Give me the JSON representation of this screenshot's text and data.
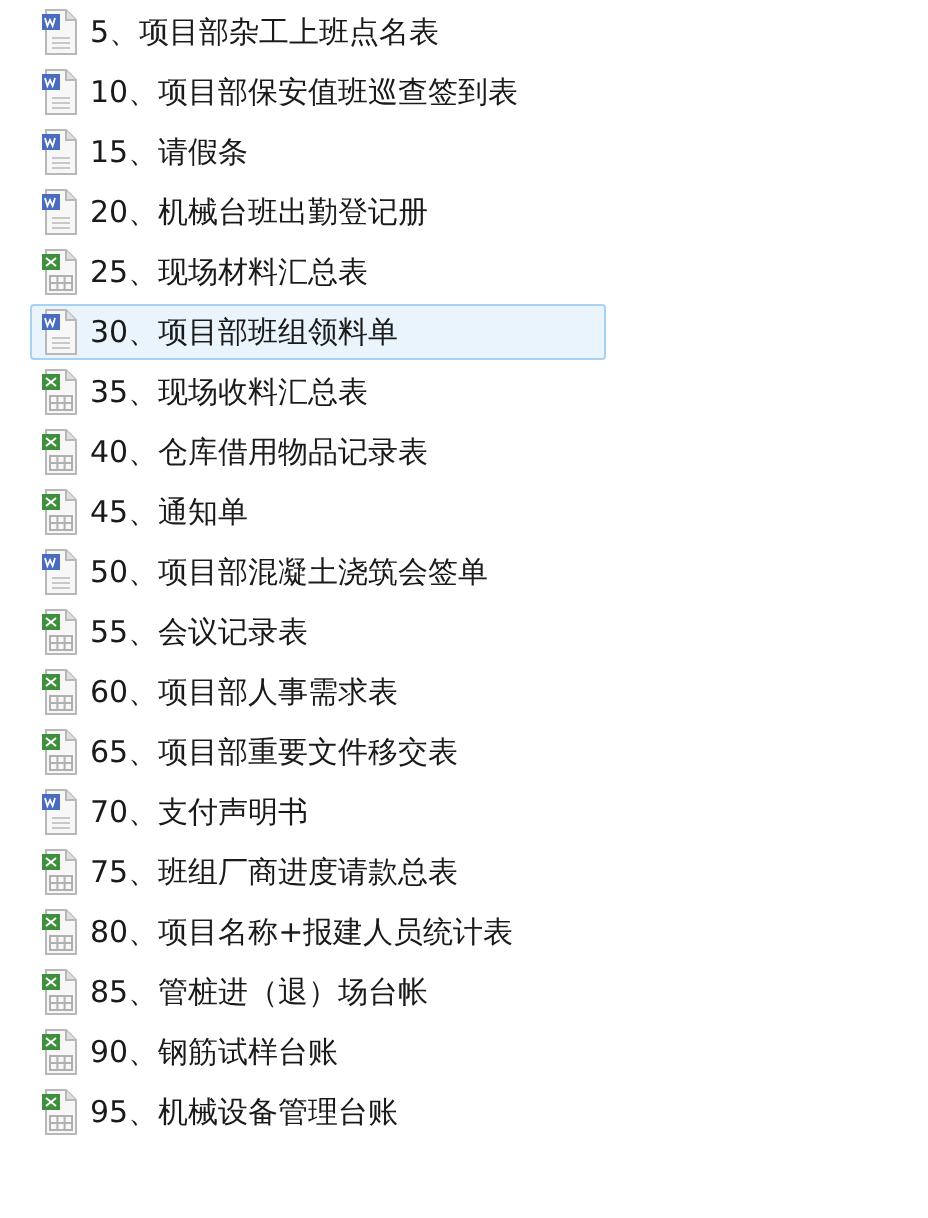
{
  "files": [
    {
      "name": "5、项目部杂工上班点名表",
      "kind": "word",
      "selected": false
    },
    {
      "name": "10、项目部保安值班巡查签到表",
      "kind": "word",
      "selected": false
    },
    {
      "name": "15、请假条",
      "kind": "word",
      "selected": false
    },
    {
      "name": "20、机械台班出勤登记册",
      "kind": "word",
      "selected": false
    },
    {
      "name": "25、现场材料汇总表",
      "kind": "excel",
      "selected": false
    },
    {
      "name": "30、项目部班组领料单",
      "kind": "word",
      "selected": true
    },
    {
      "name": "35、现场收料汇总表",
      "kind": "excel",
      "selected": false
    },
    {
      "name": "40、仓库借用物品记录表",
      "kind": "excel",
      "selected": false
    },
    {
      "name": "45、通知单",
      "kind": "excel",
      "selected": false
    },
    {
      "name": "50、项目部混凝土浇筑会签单",
      "kind": "word",
      "selected": false
    },
    {
      "name": "55、会议记录表",
      "kind": "excel",
      "selected": false
    },
    {
      "name": "60、项目部人事需求表",
      "kind": "excel",
      "selected": false
    },
    {
      "name": "65、项目部重要文件移交表",
      "kind": "excel",
      "selected": false
    },
    {
      "name": "70、支付声明书",
      "kind": "word",
      "selected": false
    },
    {
      "name": "75、班组厂商进度请款总表",
      "kind": "excel",
      "selected": false
    },
    {
      "name": "80、项目名称+报建人员统计表",
      "kind": "excel",
      "selected": false
    },
    {
      "name": "85、管桩进（退）场台帐",
      "kind": "excel",
      "selected": false
    },
    {
      "name": "90、钢筋试样台账",
      "kind": "excel",
      "selected": false
    },
    {
      "name": "95、机械设备管理台账",
      "kind": "excel",
      "selected": false
    }
  ]
}
